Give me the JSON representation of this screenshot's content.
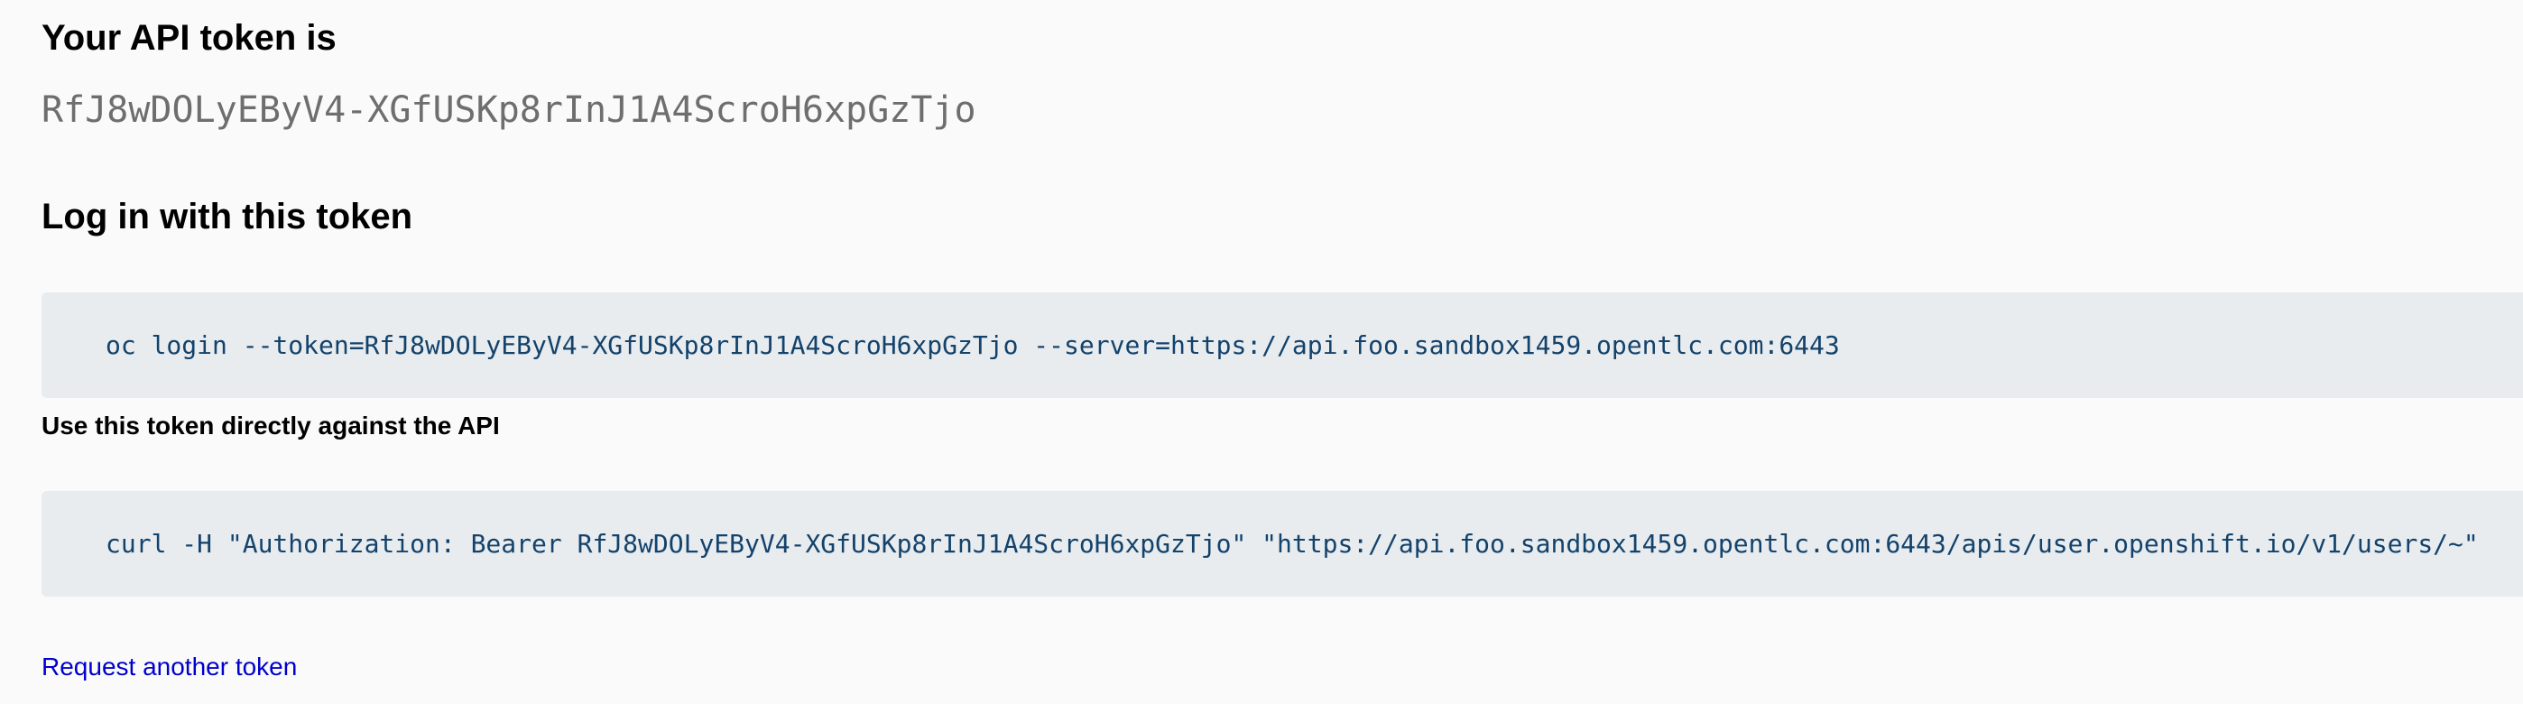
{
  "token_section": {
    "title": "Your API token is",
    "token": "RfJ8wDOLyEByV4-XGfUSKp8rInJ1A4ScroH6xpGzTjo"
  },
  "login_section": {
    "title": "Log in with this token",
    "command": "oc login --token=RfJ8wDOLyEByV4-XGfUSKp8rInJ1A4ScroH6xpGzTjo --server=https://api.foo.sandbox1459.opentlc.com:6443"
  },
  "api_section": {
    "title": "Use this token directly against the API",
    "command": "curl -H \"Authorization: Bearer RfJ8wDOLyEByV4-XGfUSKp8rInJ1A4ScroH6xpGzTjo\" \"https://api.foo.sandbox1459.opentlc.com:6443/apis/user.openshift.io/v1/users/~\""
  },
  "footer": {
    "request_link_label": "Request another token"
  },
  "colors": {
    "background": "#fafafa",
    "token_text": "#6e6e6e",
    "code_background": "#e8ecef",
    "code_text": "#13426b",
    "link": "#0000cc"
  }
}
